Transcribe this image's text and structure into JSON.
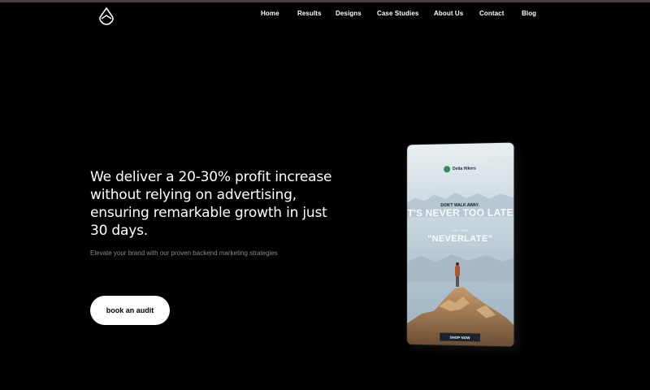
{
  "nav": {
    "items": [
      {
        "label": "Home"
      },
      {
        "label": "Results"
      },
      {
        "label": "Designs"
      },
      {
        "label": "Case Studies"
      },
      {
        "label": "About Us"
      },
      {
        "label": "Contact"
      },
      {
        "label": "Blog"
      }
    ]
  },
  "hero": {
    "title": "We deliver a 20-30% profit increase without relying on advertising, ensuring remarkable growth in just 30 days.",
    "subtitle": "Elevate your brand with our proven backend marketing strategies",
    "cta_label": "book an audit"
  },
  "ad": {
    "brand": "Delta Hikers",
    "kicker": "DON'T WALK AWAY.",
    "headline": "IT'S NEVER TOO LATE.",
    "small_text": "USE CODE",
    "code": "\"NEVERLATE\"",
    "shop_label": "SHOP NOW"
  },
  "colors": {
    "background": "#000000",
    "text": "#ffffff",
    "subtext": "#8a8a8a",
    "cta_bg": "#ffffff"
  }
}
